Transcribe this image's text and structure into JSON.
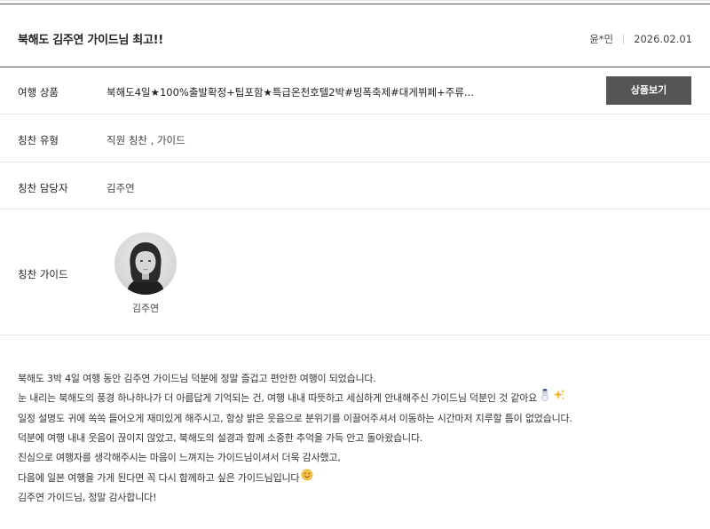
{
  "review": {
    "title": "북해도 김주연 가이드님 최고!!",
    "author": "윤*민",
    "date": "2026.02.01",
    "body_lines": [
      "북해도 3박 4일 여행 동안 김주연 가이드님 덕분에 정말 즐겁고 편안한 여행이 되었습니다.",
      "눈 내리는 북해도의 풍경 하나하나가 더 아름답게 기억되는 건, 여행 내내 따뜻하고 세심하게 안내해주신 가이드님 덕분인 것 같아요",
      "일정 설명도 귀에 쏙쏙 들어오게 재미있게 해주시고, 항상 밝은 웃음으로 분위기를 이끌어주셔서 이동하는 시간마저 지루할 틈이 없었습니다.",
      "덕분에 여행 내내 웃음이 끊이지 않았고, 북해도의 설경과 함께 소중한 추억을 가득 안고 돌아왔습니다.",
      "진심으로 여행자를 생각해주시는 마음이 느껴지는 가이드님이셔서 더욱 감사했고,",
      "다음에 일본 여행을 가게 된다면 꼭 다시 함께하고 싶은 가이드님입니다",
      "김주연 가이드님, 정말 감사합니다!"
    ]
  },
  "fields": {
    "product": {
      "label": "여행 상품",
      "value": "북해도4일★100%출발확정+팁포함★특급온천호텔2박#빙폭축제#대게뷔페+주류...",
      "button": "상품보기"
    },
    "praise_type": {
      "label": "칭찬 유형",
      "value": "직원 칭찬 , 가이드"
    },
    "praise_manager": {
      "label": "칭찬 담당자",
      "value": "김주연"
    },
    "praise_guide": {
      "label": "칭찬 가이드",
      "guide_name": "김주연"
    }
  },
  "icons": {
    "snowman": "snowman-icon",
    "sparkles": "sparkles-icon",
    "smile": "smiling-face-icon"
  },
  "colors": {
    "header_border": "#555555",
    "button_bg": "#555555",
    "divider": "#e6e6e6",
    "text": "#333333"
  }
}
